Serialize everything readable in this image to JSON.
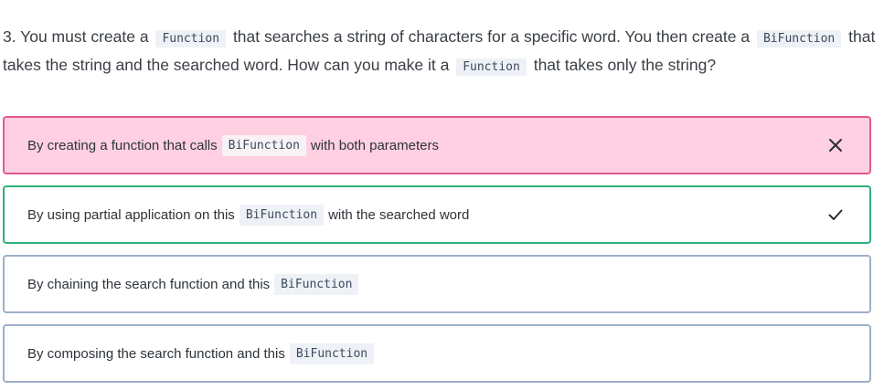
{
  "question": {
    "text_1": "3. You must create a",
    "code_1": "Function",
    "text_2": "that searches a string of characters for a specific word. You then create a",
    "code_2": "BiFunction",
    "text_3": "that takes the string and the searched word. How can you make it a",
    "code_3": "Function",
    "text_4": "that takes only the string?"
  },
  "options": [
    {
      "before": "By creating a function that calls",
      "code": "BiFunction",
      "after": "with both parameters",
      "state": "incorrect",
      "icon": "close-icon"
    },
    {
      "before": "By using partial application on this",
      "code": "BiFunction",
      "after": "with the searched word",
      "state": "correct",
      "icon": "check-icon"
    },
    {
      "before": "By chaining the search function and this",
      "code": "BiFunction",
      "after": "",
      "state": "neutral"
    },
    {
      "before": "By composing the search function and this",
      "code": "BiFunction",
      "after": "",
      "state": "neutral"
    }
  ],
  "colors": {
    "incorrect_border": "#e05a90",
    "incorrect_background": "#ffd0e2",
    "correct_border": "#2fb07a",
    "neutral_border": "#9eb0c9",
    "code_background": "#eef1f5"
  }
}
